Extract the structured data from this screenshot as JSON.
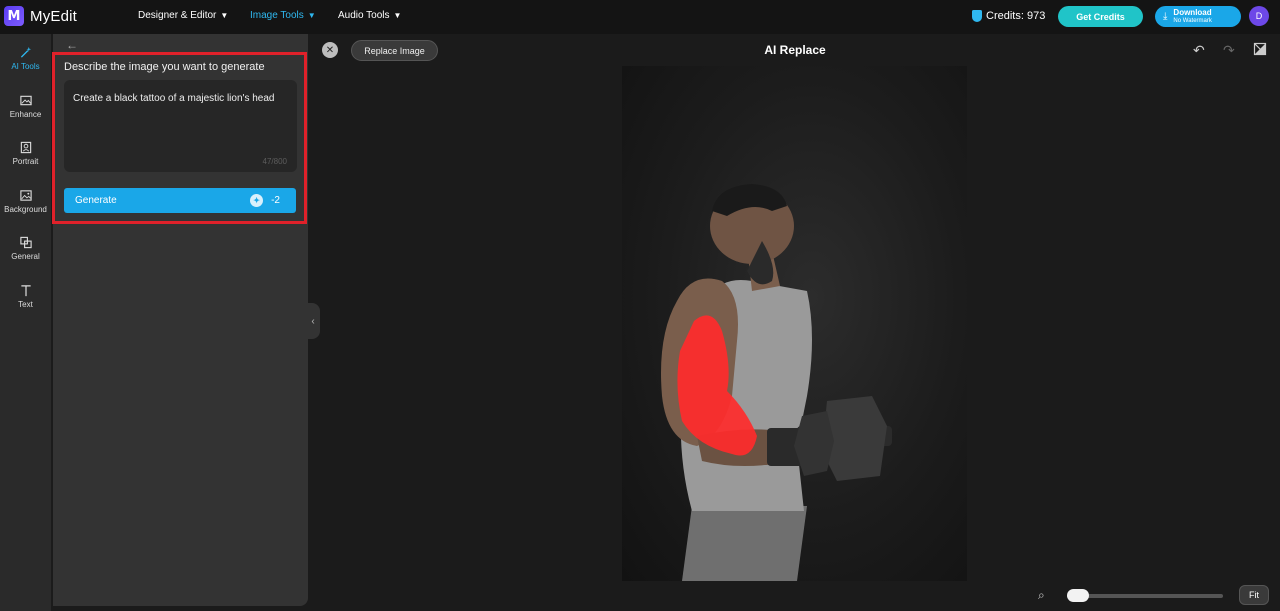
{
  "app": {
    "name": "MyEdit",
    "logo_letter": "M"
  },
  "nav": [
    {
      "label": "Designer & Editor",
      "active": false
    },
    {
      "label": "Image Tools",
      "active": true
    },
    {
      "label": "Audio Tools",
      "active": false
    }
  ],
  "header": {
    "credits": "Credits: 973",
    "get_credits": "Get Credits",
    "download": "Download",
    "download_sub": "No Watermark",
    "avatar": "D"
  },
  "rail": [
    {
      "label": "AI Tools",
      "icon": "wand-icon",
      "active": true
    },
    {
      "label": "Enhance",
      "icon": "image-enhance-icon",
      "active": false
    },
    {
      "label": "Portrait",
      "icon": "portrait-icon",
      "active": false
    },
    {
      "label": "Background",
      "icon": "background-icon",
      "active": false
    },
    {
      "label": "General",
      "icon": "layers-icon",
      "active": false
    },
    {
      "label": "Text",
      "icon": "text-icon",
      "active": false
    }
  ],
  "panel": {
    "title": "Describe the image you want to generate",
    "prompt_value": "Create a black tattoo of a majestic lion's head",
    "counter": "47/800",
    "generate": "Generate",
    "cost": "-2"
  },
  "canvas": {
    "replace_label": "Replace Image",
    "title": "AI Replace",
    "fit_label": "Fit",
    "mask_color": "#ff2b2b"
  },
  "colors": {
    "accent": "#1aa7e8",
    "highlight": "#e0212a"
  }
}
